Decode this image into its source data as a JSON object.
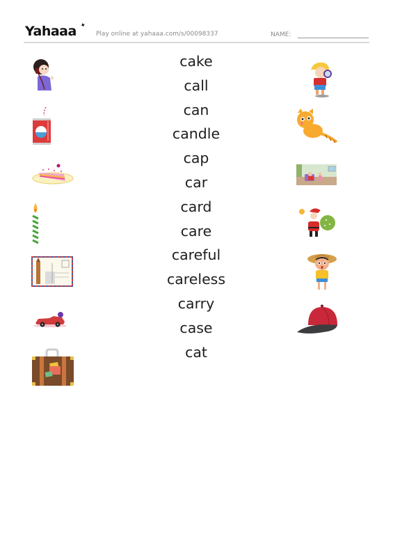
{
  "header": {
    "logo": "Yahaaa",
    "play_online": "Play online at yahaaa.com/s/00098337",
    "name_label": "NAME:"
  },
  "words": [
    "cake",
    "call",
    "can",
    "candle",
    "cap",
    "car",
    "card",
    "care",
    "careful",
    "careless",
    "carry",
    "case",
    "cat"
  ],
  "left_pictures": [
    {
      "icon": "girl-on-phone-icon",
      "label": "call"
    },
    {
      "icon": "soda-can-icon",
      "label": "can"
    },
    {
      "icon": "cake-slice-icon",
      "label": "cake"
    },
    {
      "icon": "candle-icon",
      "label": "candle"
    },
    {
      "icon": "postcard-icon",
      "label": "card"
    },
    {
      "icon": "red-car-icon",
      "label": "car"
    },
    {
      "icon": "suitcase-icon",
      "label": "case"
    }
  ],
  "right_pictures": [
    {
      "icon": "boy-magnifying-glass-icon",
      "label": "careful"
    },
    {
      "icon": "cat-icon",
      "label": "cat"
    },
    {
      "icon": "messy-room-icon",
      "label": "careless"
    },
    {
      "icon": "santa-carrying-sack-icon",
      "label": "carry"
    },
    {
      "icon": "boy-with-hat-icon",
      "label": "care"
    },
    {
      "icon": "baseball-cap-icon",
      "label": "cap"
    }
  ]
}
